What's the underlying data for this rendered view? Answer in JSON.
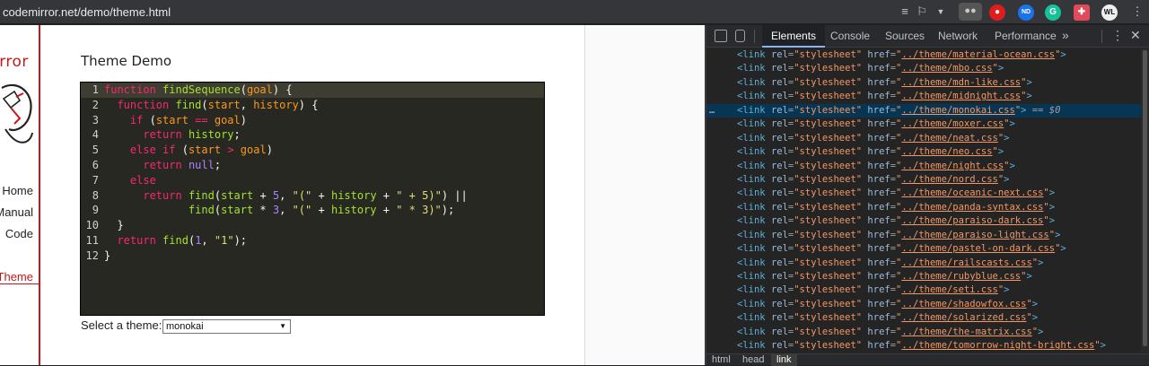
{
  "browser": {
    "url": "codemirror.net/demo/theme.html"
  },
  "sidebar": {
    "logo_text": "irror",
    "nav": [
      {
        "label": "Home"
      },
      {
        "label": "Manual"
      },
      {
        "label": "Code"
      },
      {
        "label": "Theme"
      }
    ]
  },
  "main": {
    "title": "Theme Demo",
    "theme_label": "Select a theme:",
    "theme_selected": "monokai"
  },
  "code": {
    "line_numbers": [
      "1",
      "2",
      "3",
      "4",
      "5",
      "6",
      "7",
      "8",
      "9",
      "10",
      "11",
      "12"
    ]
  },
  "devtools": {
    "tabs": [
      "Elements",
      "Console",
      "Sources",
      "Network",
      "Performance"
    ],
    "more": "»",
    "link_prefix": "../theme/",
    "themes": [
      "material-ocean.css",
      "mbo.css",
      "mdn-like.css",
      "midnight.css",
      "monokai.css",
      "moxer.css",
      "neat.css",
      "neo.css",
      "night.css",
      "nord.css",
      "oceanic-next.css",
      "panda-syntax.css",
      "paraiso-dark.css",
      "paraiso-light.css",
      "pastel-on-dark.css",
      "railscasts.css",
      "rubyblue.css",
      "seti.css",
      "shadowfox.css",
      "solarized.css",
      "the-matrix.css",
      "tomorrow-night-bright.css"
    ],
    "selected_index": 4,
    "selected_suffix": "== $0",
    "breadcrumbs": [
      "html",
      "head",
      "link"
    ]
  },
  "colors": {
    "accent": "#c21a1a",
    "editor_bg": "#272822",
    "selection": "#073655"
  }
}
